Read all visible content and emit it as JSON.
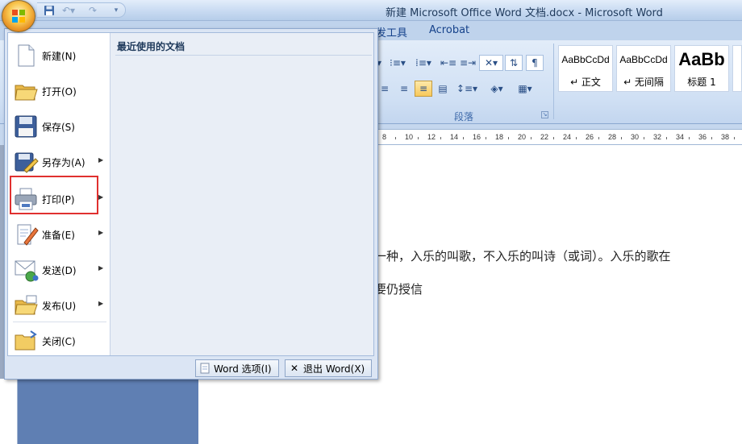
{
  "window": {
    "title": "新建 Microsoft Office Word 文档.docx - Microsoft Word"
  },
  "quick_access": {
    "save_icon": "floppy-icon",
    "undo_icon": "undo-icon",
    "redo_icon": "redo-icon"
  },
  "ribbon": {
    "tabs": [
      "发工具",
      "Acrobat"
    ],
    "paragraph_group_label": "段落",
    "styles": [
      {
        "sample": "AaBbCcDd",
        "name": "↵ 正文"
      },
      {
        "sample": "AaBbCcDd",
        "name": "↵ 无间隔"
      },
      {
        "sample": "AaBb",
        "name": "标题 1"
      }
    ]
  },
  "ruler": {
    "numbers": [
      "8",
      "10",
      "12",
      "14",
      "16",
      "18",
      "20",
      "22",
      "24",
      "26",
      "28",
      "30",
      "32",
      "34",
      "36",
      "38"
    ]
  },
  "document": {
    "lines": [
      "一种，入乐的叫歌，不入乐的叫诗（或词）。入乐的歌在",
      "要仍授信"
    ]
  },
  "office_menu": {
    "items": [
      {
        "label": "新建(N)",
        "icon": "new-document-icon",
        "submenu": false
      },
      {
        "label": "打开(O)",
        "icon": "open-folder-icon",
        "submenu": false
      },
      {
        "label": "保存(S)",
        "icon": "save-icon",
        "submenu": false
      },
      {
        "label": "另存为(A)",
        "icon": "save-as-icon",
        "submenu": true
      },
      {
        "label": "打印(P)",
        "icon": "print-icon",
        "submenu": true
      },
      {
        "label": "准备(E)",
        "icon": "prepare-icon",
        "submenu": true
      },
      {
        "label": "发送(D)",
        "icon": "send-icon",
        "submenu": true
      },
      {
        "label": "发布(U)",
        "icon": "publish-icon",
        "submenu": true
      },
      {
        "label": "关闭(C)",
        "icon": "close-folder-icon",
        "submenu": false
      }
    ],
    "recent_title": "最近使用的文档",
    "word_options_label": "Word 选项(I)",
    "exit_word_label": "退出 Word(X)",
    "highlight_color": "#e0302f"
  }
}
